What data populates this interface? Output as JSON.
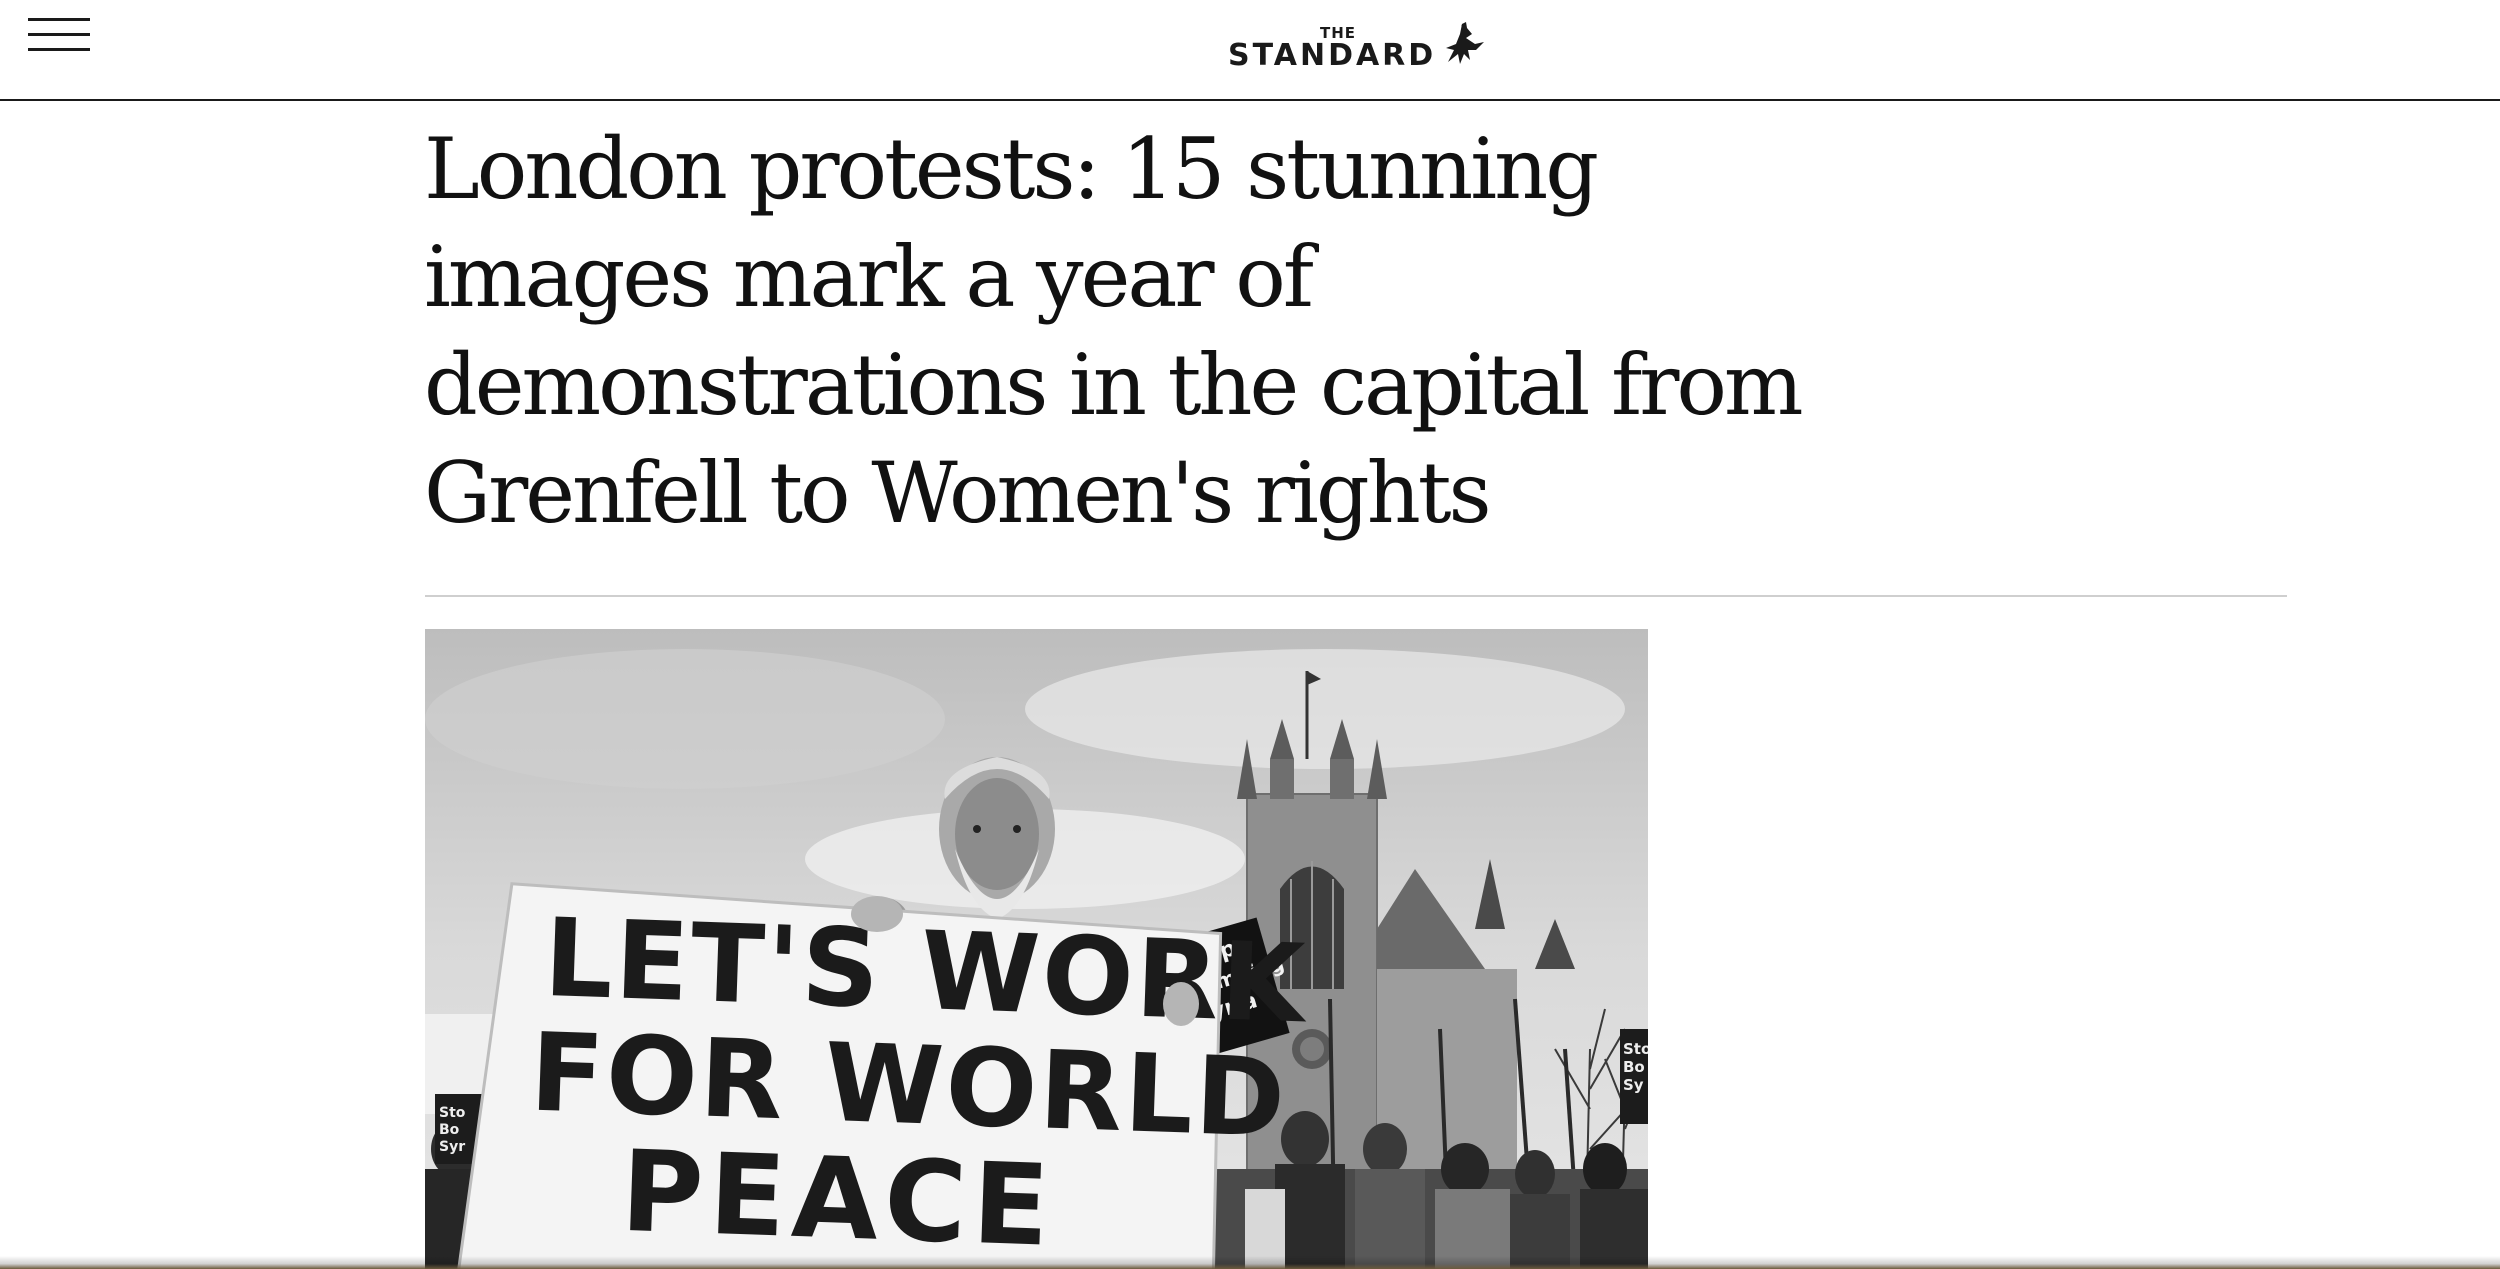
{
  "header": {
    "menu_icon": "hamburger-menu-icon",
    "logo_top": "THE",
    "logo_name": "STANDARD",
    "logo_icon": "flying-bird-icon"
  },
  "article": {
    "headline_lines": [
      "London protests: 15 stunning",
      "images mark a year of",
      "demonstrations in the capital from",
      "Grenfell to Women's rights"
    ]
  },
  "hero_image": {
    "placard_lines": [
      "LET'S WORK",
      "FOR WORLD",
      "PEACE"
    ],
    "small_sign_lines": [
      "Stop",
      "Bombing",
      "Syria"
    ],
    "left_sign_lines": [
      "Sto",
      "Bo",
      "Syr"
    ],
    "right_sign_lines": [
      "Sto",
      "Bo",
      "Sy"
    ]
  }
}
